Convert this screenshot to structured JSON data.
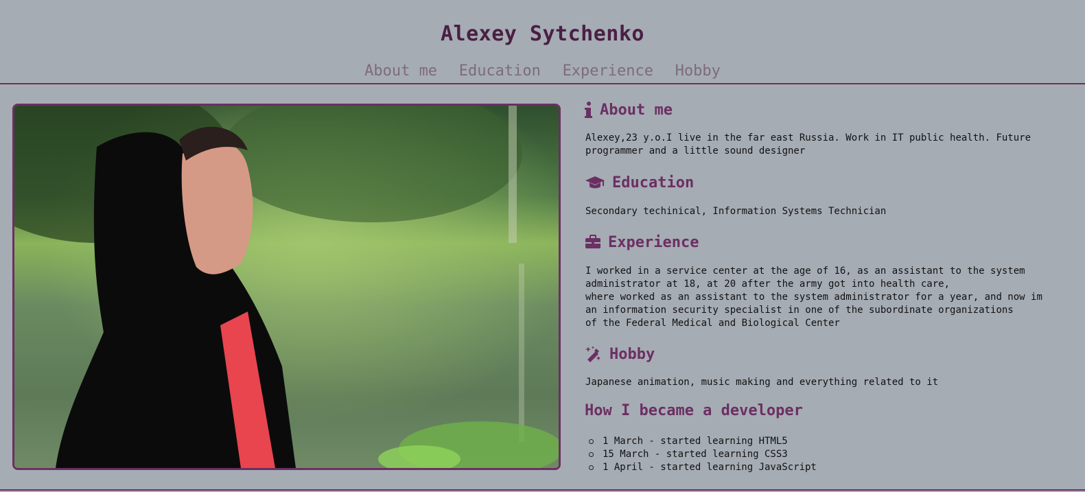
{
  "header": {
    "title": "Alexey Sytchenko",
    "nav": [
      "About me",
      "Education",
      "Experience",
      "Hobby"
    ]
  },
  "sections": {
    "about": {
      "icon": "info-icon",
      "title": "About me",
      "text_lines": [
        "Alexey,23 y.o.I live in the far east Russia. Work in IT public health. Future",
        "programmer and a little sound designer"
      ]
    },
    "education": {
      "icon": "graduation-cap-icon",
      "title": "Education",
      "text_lines": [
        "Secondary techinical, Information Systems Technician"
      ]
    },
    "experience": {
      "icon": "briefcase-icon",
      "title": "Experience",
      "text_lines": [
        "I worked in a service center at the age of 16, as an assistant to the system",
        "administrator at 18, at 20 after the army got into health care,",
        "where worked as an assistant to the system administrator for a year, and now im",
        "an information security specialist in one of the subordinate organizations",
        "of the Federal Medical and Biological Center"
      ]
    },
    "hobby": {
      "icon": "magic-wand-icon",
      "title": "Hobby",
      "text_lines": [
        "Japanese animation, music making and everything related to it"
      ]
    },
    "developer": {
      "title": "How I became a developer",
      "items": [
        "1 March - started learning HTML5",
        "15 March - started learning CSS3",
        "1 April - started learning JavaScript"
      ]
    }
  },
  "colors": {
    "background": "#a6acb4",
    "accent": "#6b2f63",
    "title": "#4a1f44",
    "nav": "#7d6b7d"
  }
}
